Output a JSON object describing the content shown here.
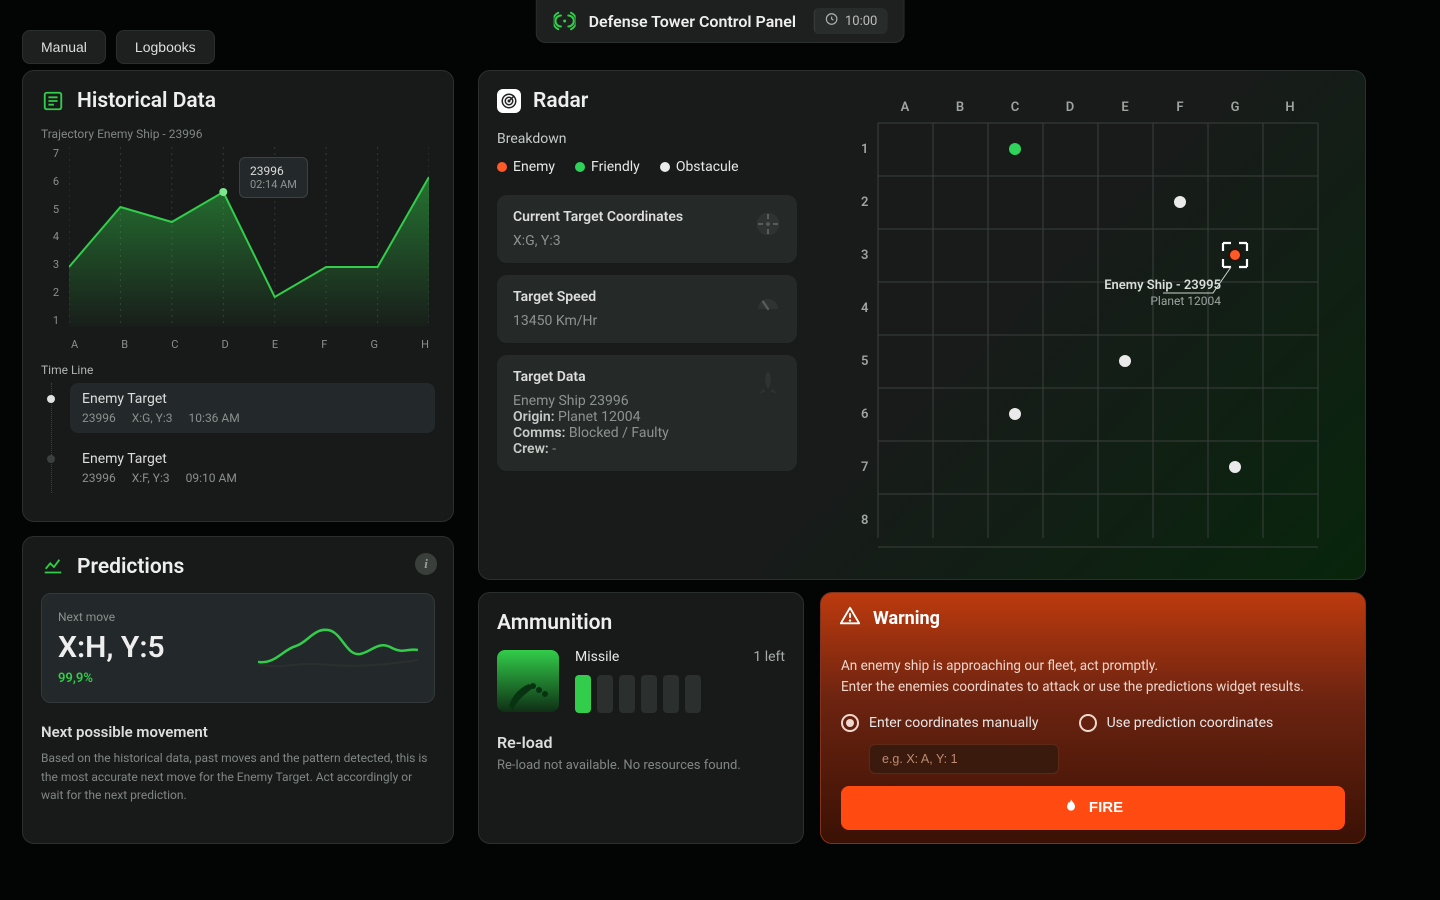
{
  "header": {
    "title": "Defense Tower Control Panel",
    "timer": "10:00"
  },
  "tabs": {
    "manual": "Manual",
    "logbooks": "Logbooks"
  },
  "historical": {
    "title": "Historical Data",
    "chart_caption": "Trajectory Enemy Ship - 23996",
    "tooltip": {
      "ship": "23996",
      "time": "02:14 AM"
    },
    "timeline_title": "Time Line",
    "timeline": [
      {
        "label": "Enemy Target",
        "id": "23996",
        "coord": "X:G, Y:3",
        "time": "10:36 AM",
        "active": true
      },
      {
        "label": "Enemy Target",
        "id": "23996",
        "coord": "X:F, Y:3",
        "time": "09:10 AM",
        "active": false
      }
    ]
  },
  "chart_data": {
    "type": "line",
    "categories": [
      "A",
      "B",
      "C",
      "D",
      "E",
      "F",
      "G",
      "H"
    ],
    "values": [
      3,
      5,
      4.5,
      5.5,
      2,
      3,
      3,
      6
    ],
    "xlabel": "",
    "ylabel": "",
    "ylim": [
      1,
      7
    ]
  },
  "predictions": {
    "title": "Predictions",
    "next_move_label": "Next move",
    "next_move": "X:H, Y:5",
    "accuracy": "99,9%",
    "sub_title": "Next possible movement",
    "sub_body": "Based on the historical data, past moves and the pattern detected, this is the most accurate next move for the Enemy Target.\nAct accordingly or wait for the next prediction."
  },
  "radar": {
    "title": "Radar",
    "breakdown_label": "Breakdown",
    "legend": {
      "enemy": "Enemy",
      "friendly": "Friendly",
      "obstacle": "Obstacule"
    },
    "cards": {
      "coord": {
        "title": "Current Target Coordinates",
        "value": "X:G, Y:3"
      },
      "speed": {
        "title": "Target Speed",
        "value": "13450 Km/Hr"
      },
      "data": {
        "title": "Target Data",
        "name": "Enemy Ship 23996",
        "origin_label": "Origin:",
        "origin": "Planet 12004",
        "comms_label": "Comms:",
        "comms": "Blocked / Faulty",
        "crew_label": "Crew:",
        "crew": "-"
      }
    },
    "grid": {
      "cols": [
        "A",
        "B",
        "C",
        "D",
        "E",
        "F",
        "G",
        "H"
      ],
      "rows": [
        "1",
        "2",
        "3",
        "4",
        "5",
        "6",
        "7",
        "8"
      ],
      "points": [
        {
          "col": "C",
          "row": 1,
          "kind": "friendly"
        },
        {
          "col": "C",
          "row": 6,
          "kind": "obstacle"
        },
        {
          "col": "E",
          "row": 5,
          "kind": "obstacle"
        },
        {
          "col": "F",
          "row": 2,
          "kind": "obstacle"
        },
        {
          "col": "G",
          "row": 3,
          "kind": "enemy",
          "target": true,
          "label": "Enemy Ship - 23995",
          "sublabel": "Planet 12004"
        },
        {
          "col": "H",
          "row": 7,
          "kind": "obstacle"
        }
      ]
    }
  },
  "ammo": {
    "title": "Ammunition",
    "name": "Missile",
    "left": "1 left",
    "bars_total": 6,
    "bars_on": 1,
    "reload_title": "Re-load",
    "reload_msg": "Re-load not available. No resources found."
  },
  "warning": {
    "title": "Warning",
    "msg_l1": "An enemy ship is approaching our fleet, act promptly.",
    "msg_l2": "Enter the enemies coordinates to attack or use the predictions widget results.",
    "opt_manual": "Enter coordinates manually",
    "opt_predict": "Use prediction coordinates",
    "placeholder": "e.g. X: A, Y: 1",
    "fire": "FIRE"
  }
}
